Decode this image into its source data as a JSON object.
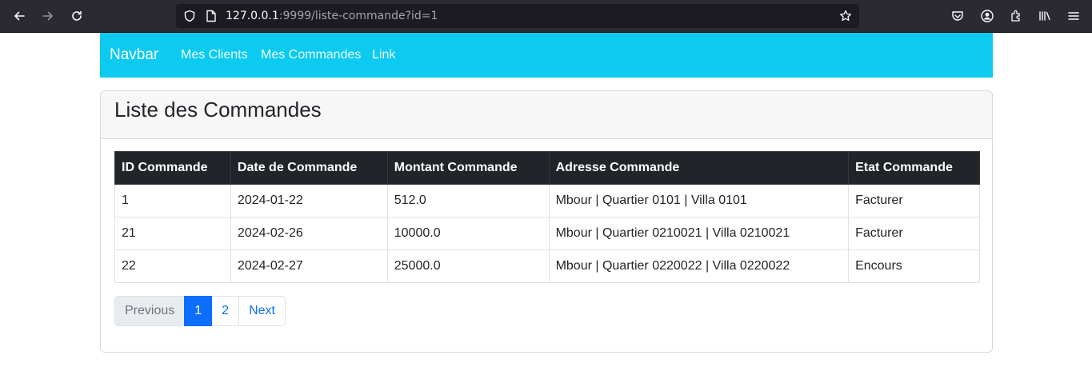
{
  "browser": {
    "url_host": "127.0.0.1",
    "url_rest": ":9999/liste-commande?id=1"
  },
  "navbar": {
    "brand": "Navbar",
    "links": [
      "Mes Clients",
      "Mes Commandes",
      "Link"
    ],
    "color": "#0dcaf0"
  },
  "card": {
    "title": "Liste des Commandes"
  },
  "table": {
    "headers": [
      "ID Commande",
      "Date de Commande",
      "Montant Commande",
      "Adresse Commande",
      "Etat Commande"
    ],
    "rows": [
      [
        "1",
        "2024-01-22",
        "512.0",
        "Mbour | Quartier 0101 | Villa 0101",
        "Facturer"
      ],
      [
        "21",
        "2024-02-26",
        "10000.0",
        "Mbour | Quartier 0210021 | Villa 0210021",
        "Facturer"
      ],
      [
        "22",
        "2024-02-27",
        "25000.0",
        "Mbour | Quartier 0220022 | Villa 0220022",
        "Encours"
      ]
    ]
  },
  "pagination": {
    "previous": "Previous",
    "pages": [
      "1",
      "2"
    ],
    "next": "Next",
    "active_page": "1"
  }
}
